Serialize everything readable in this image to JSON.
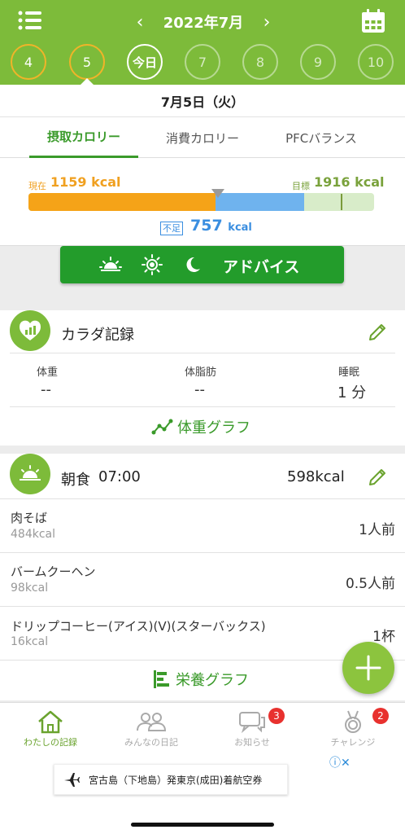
{
  "header": {
    "month_title": "2022年7月",
    "prev_arrow": "‹",
    "next_arrow": "›",
    "days": [
      {
        "label": "4",
        "state": "done"
      },
      {
        "label": "5",
        "state": "done"
      },
      {
        "label": "今日",
        "state": "today"
      },
      {
        "label": "7",
        "state": "future"
      },
      {
        "label": "8",
        "state": "future"
      },
      {
        "label": "9",
        "state": "future"
      },
      {
        "label": "10",
        "state": "future"
      }
    ]
  },
  "date_bar": {
    "date": "7月5日（火）"
  },
  "tabs": [
    {
      "label": "摂取カロリー",
      "active": true
    },
    {
      "label": "消費カロリー",
      "active": false
    },
    {
      "label": "PFCバランス",
      "active": false
    }
  ],
  "calories": {
    "current_label": "現在",
    "current_value": "1159 kcal",
    "goal_label": "目標",
    "goal_value": "1916 kcal",
    "short_label": "不足",
    "short_value": "757",
    "short_unit": "kcal",
    "eaten_kcal": 1159,
    "goal_kcal": 1916
  },
  "advice": {
    "label": "アドバイス"
  },
  "body_record": {
    "title": "カラダ記録",
    "metrics": [
      {
        "label": "体重",
        "value": "--"
      },
      {
        "label": "体脂肪",
        "value": "--"
      },
      {
        "label": "睡眠",
        "value": "1 分"
      }
    ],
    "graph_link": "体重グラフ"
  },
  "breakfast": {
    "title": "朝食",
    "time": "07:00",
    "total": "598kcal",
    "items": [
      {
        "name": "肉そば",
        "kcal": "484kcal",
        "amount": "1人前"
      },
      {
        "name": "バームクーヘン",
        "kcal": "98kcal",
        "amount": "0.5人前"
      },
      {
        "name": "ドリップコーヒー(アイス)(V)(スターバックス)",
        "kcal": "16kcal",
        "amount": "1杯"
      }
    ],
    "graph_link": "栄養グラフ"
  },
  "bottom_nav": [
    {
      "label": "わたしの記録",
      "active": true,
      "badge": ""
    },
    {
      "label": "みんなの日記",
      "active": false,
      "badge": ""
    },
    {
      "label": "お知らせ",
      "active": false,
      "badge": "3"
    },
    {
      "label": "チャレンジ",
      "active": false,
      "badge": "2"
    }
  ],
  "ad": {
    "text": "宮古島（下地島）発東京(成田)着航空券",
    "choice": "ⓘ✕"
  },
  "colors": {
    "brand_green": "#7dbb3a",
    "accent_green": "#239c2b",
    "eaten_orange": "#f5a318",
    "remaining_blue": "#6fb3ee",
    "badge_red": "#e8312e"
  }
}
